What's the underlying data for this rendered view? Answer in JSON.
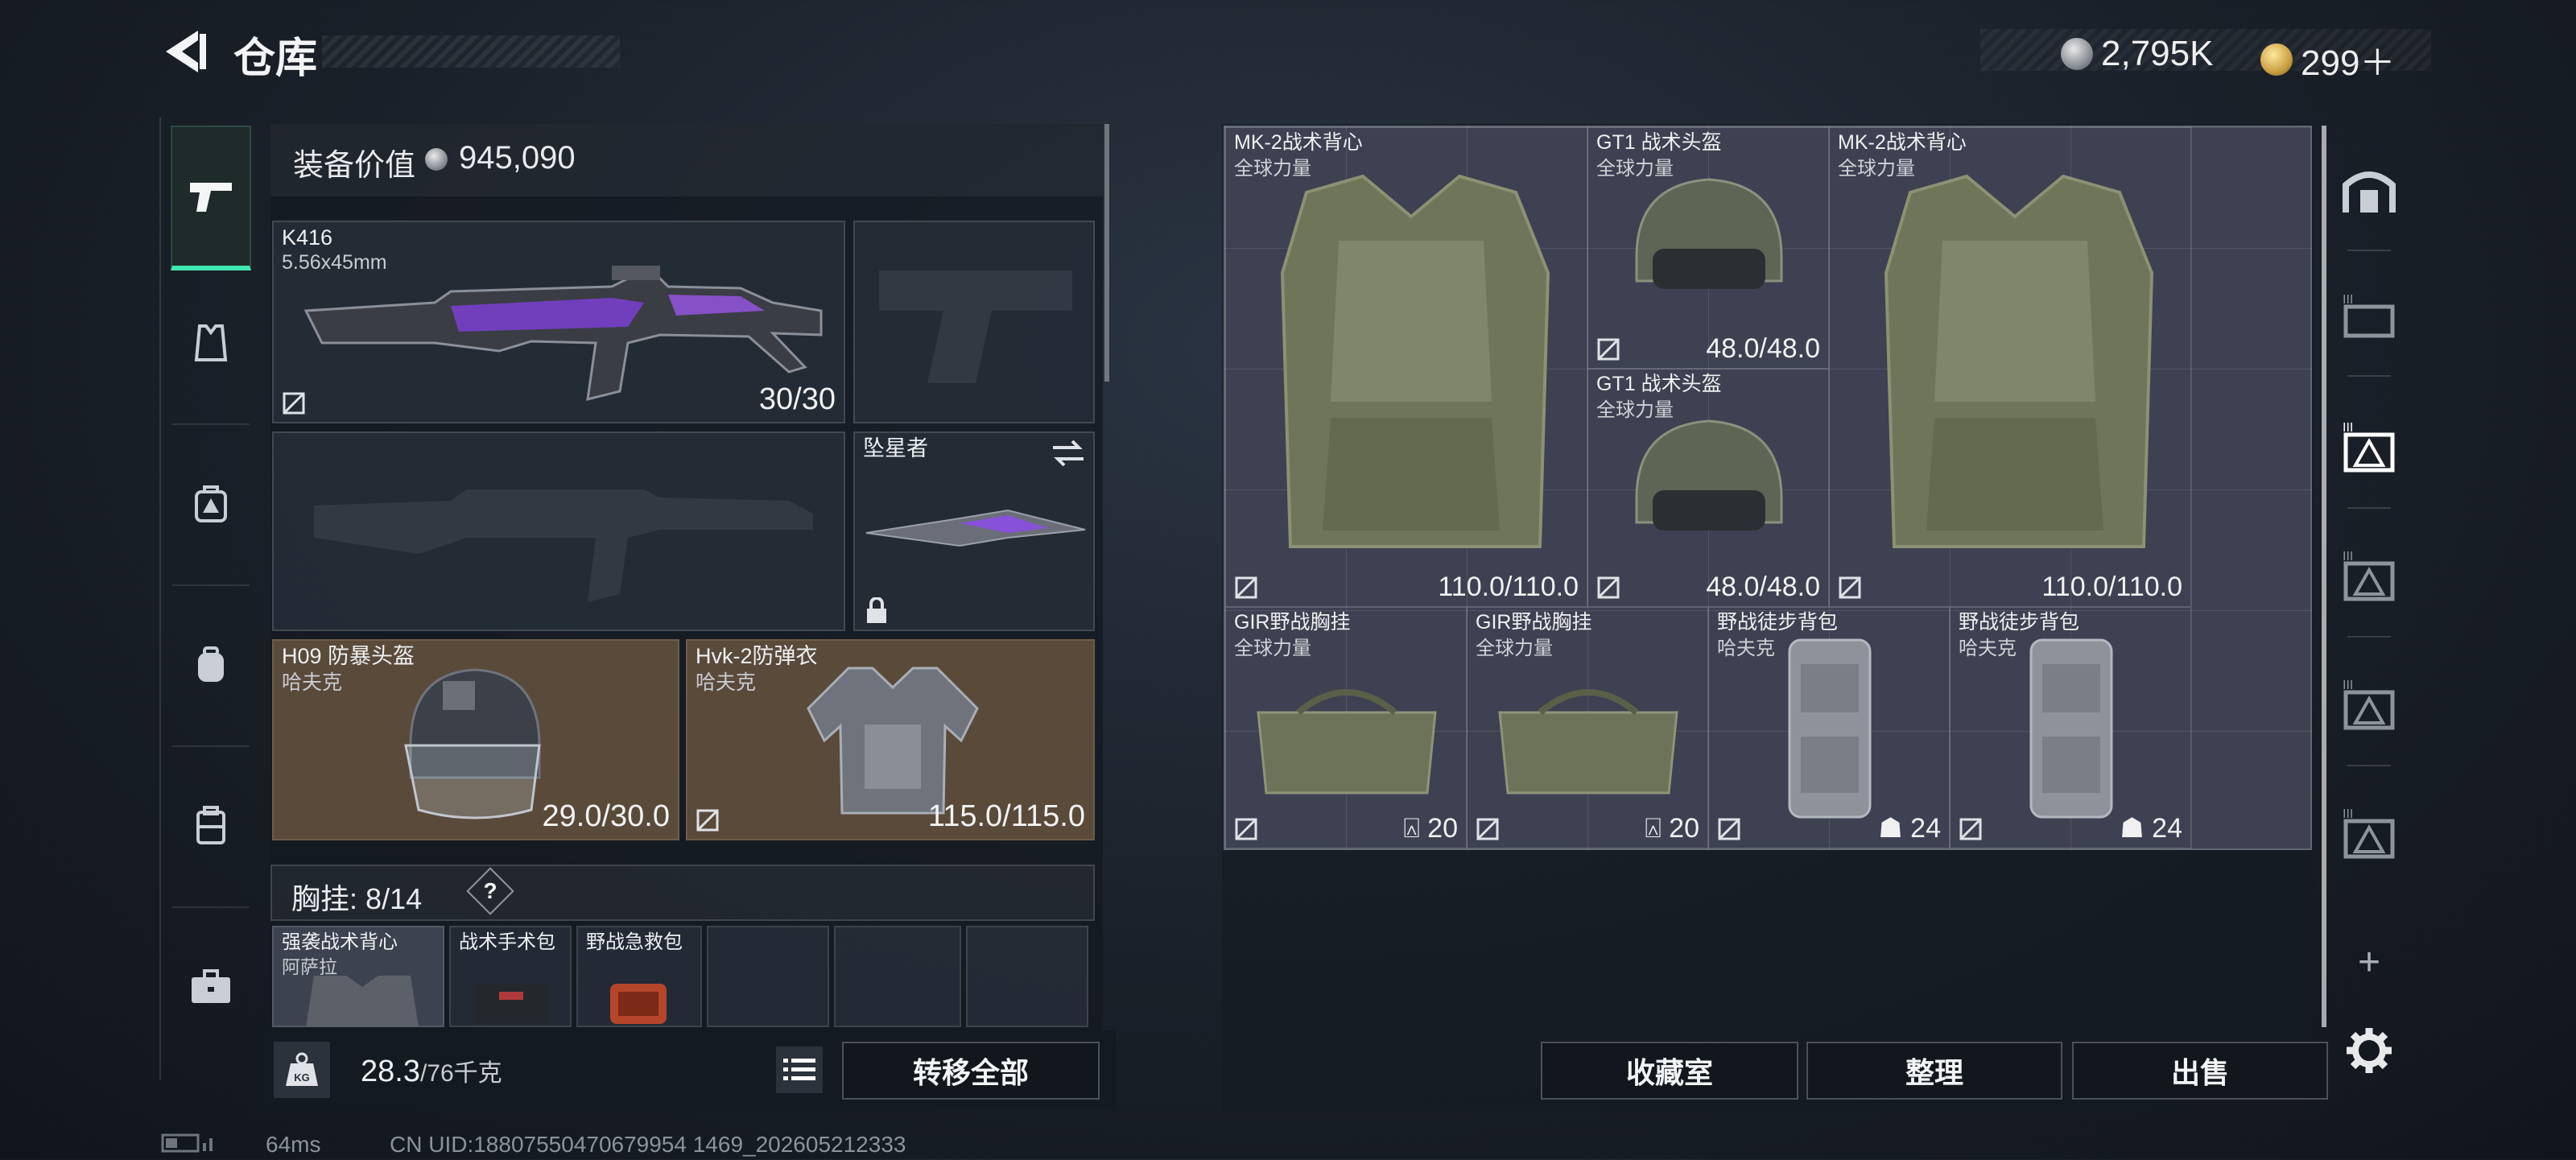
{
  "header": {
    "title": "仓库",
    "currency": [
      {
        "icon": "silver-coin-icon",
        "value": "2,795K"
      },
      {
        "icon": "gold-coin-icon",
        "value": "299＋"
      }
    ]
  },
  "rail": {
    "items": [
      {
        "name": "weapons",
        "icon": "pistol-icon",
        "active": true
      },
      {
        "name": "armor",
        "icon": "vest-icon"
      },
      {
        "name": "medical",
        "icon": "medkit-icon"
      },
      {
        "name": "backpack",
        "icon": "backpack-icon"
      },
      {
        "name": "container",
        "icon": "case-icon"
      },
      {
        "name": "toolbox",
        "icon": "toolbox-icon"
      }
    ]
  },
  "loadout": {
    "value_label": "装备价值",
    "value": "945,090",
    "primary": {
      "name": "K416",
      "ammo_type": "5.56x45mm",
      "ammo": "30/30"
    },
    "melee": {
      "name": "坠星者"
    },
    "helmet": {
      "name": "H09 防暴头盔",
      "brand": "哈夫克",
      "durability": "29.0/30.0"
    },
    "armor": {
      "name": "Hvk-2防弹衣",
      "brand": "哈夫克",
      "durability": "115.0/115.0"
    },
    "chest_rig": {
      "label": "胸挂:",
      "used": "8",
      "capacity": "/14",
      "help": "?"
    },
    "rig_items": [
      {
        "name": "强袭战术背心",
        "brand": "阿萨拉"
      },
      {
        "name": "战术手术包",
        "brand": ""
      },
      {
        "name": "野战急救包",
        "brand": ""
      }
    ],
    "weight": "28.3",
    "weight_max": "/76千克",
    "transfer_all": "转移全部"
  },
  "storage": {
    "items": [
      {
        "name": "MK-2战术背心",
        "brand": "全球力量",
        "value": "110.0/110.0"
      },
      {
        "name": "GT1 战术头盔",
        "brand": "全球力量",
        "value": "48.0/48.0"
      },
      {
        "name": "MK-2战术背心",
        "brand": "全球力量",
        "value": "110.0/110.0"
      },
      {
        "name": "GT1 战术头盔",
        "brand": "全球力量",
        "value": "48.0/48.0"
      },
      {
        "name": "GIR野战胸挂",
        "brand": "全球力量",
        "value": "20"
      },
      {
        "name": "GIR野战胸挂",
        "brand": "全球力量",
        "value": "20"
      },
      {
        "name": "野战徒步背包",
        "brand": "哈夫克",
        "value": "24"
      },
      {
        "name": "野战徒步背包",
        "brand": "哈夫克",
        "value": "24"
      }
    ],
    "buttons": {
      "collection": "收藏室",
      "sort": "整理",
      "sell": "出售"
    }
  },
  "right_tools": {
    "add": "+"
  },
  "status": {
    "ping": "64ms",
    "uid": "CN UID:18807550470679954 1469_202605212333"
  },
  "colors": {
    "accent": "#3ee6b0",
    "brown_slot": "#5a4a3a",
    "grid": "#3d4152"
  }
}
